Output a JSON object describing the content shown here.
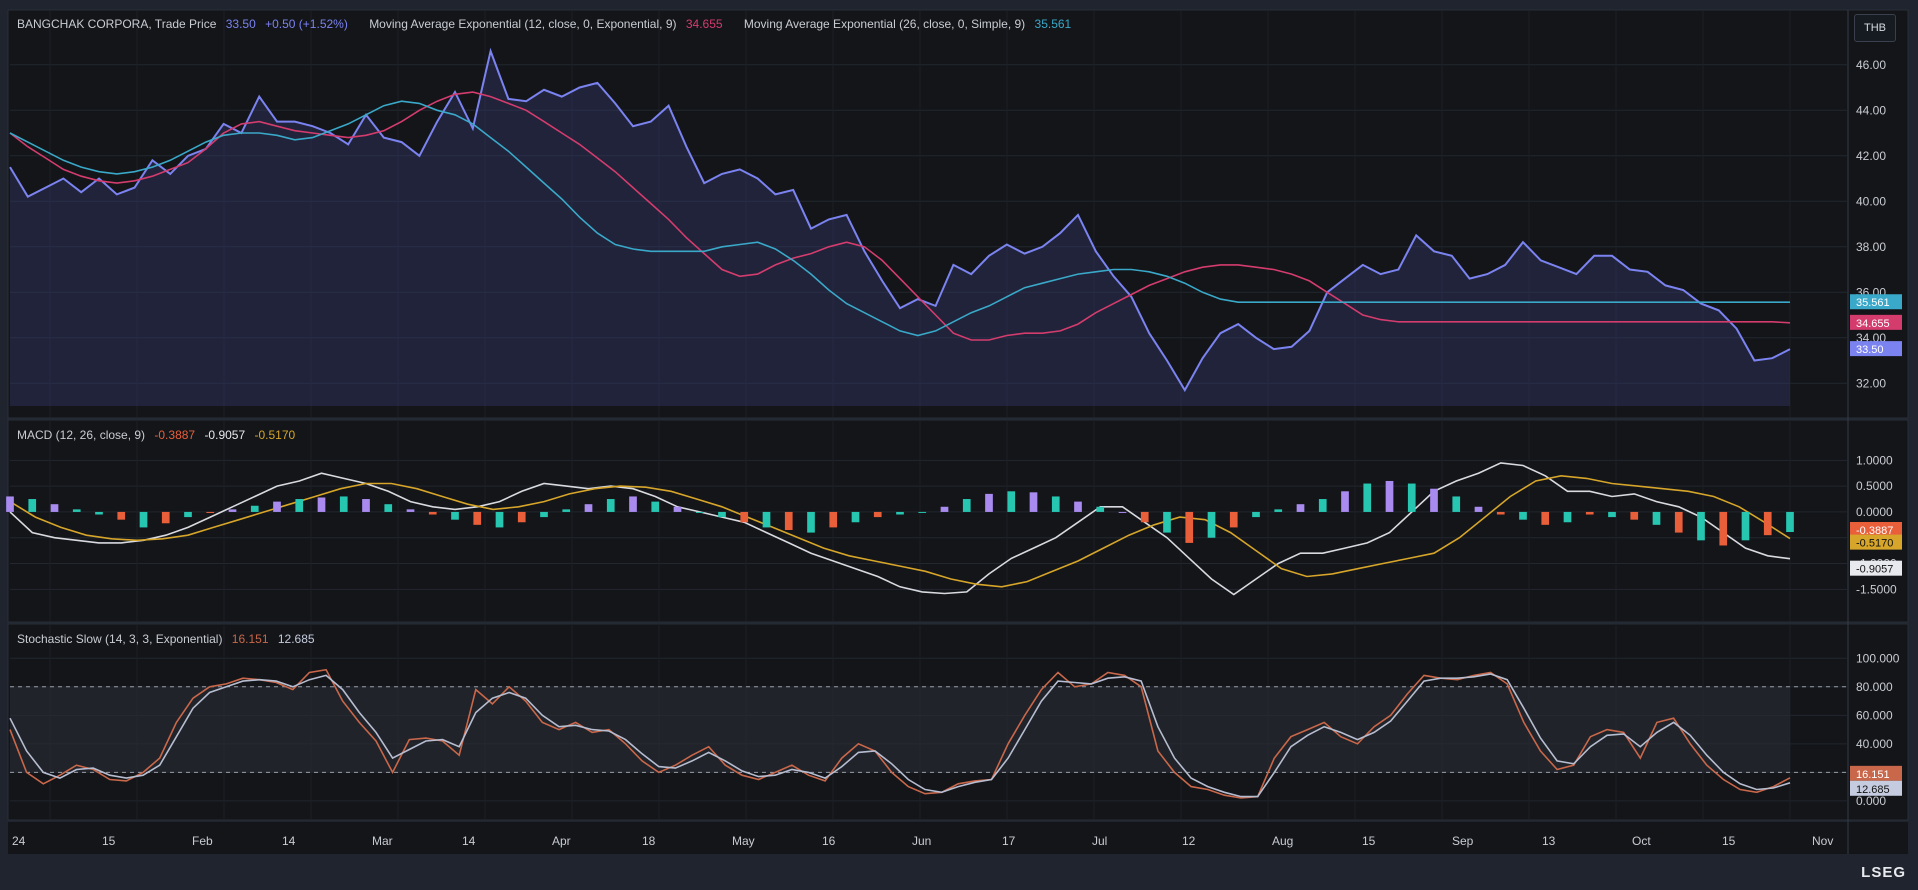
{
  "currency": "THB",
  "footer_logo": "LSEG",
  "price_legend": {
    "instrument": "BANGCHAK CORPORA, Trade Price",
    "last": "33.50",
    "change": "+0.50 (+1.52%)",
    "ema12_label": "Moving Average Exponential (12, close, 0, Exponential, 9)",
    "ema12_value": "34.655",
    "ma26_label": "Moving Average Exponential (26, close, 0, Simple, 9)",
    "ma26_value": "35.561"
  },
  "macd_legend": {
    "label": "MACD (12, 26, close, 9)",
    "hist": "-0.3887",
    "macd": "-0.9057",
    "signal": "-0.5170"
  },
  "stoch_legend": {
    "label": "Stochastic Slow (14, 3, 3, Exponential)",
    "k": "16.151",
    "d": "12.685"
  },
  "chart_data": [
    {
      "type": "line",
      "panel": "price",
      "x_index": [
        0,
        2,
        4,
        6,
        8,
        10,
        12,
        14,
        16,
        18,
        20,
        22,
        24,
        26,
        28,
        30,
        32,
        34,
        36,
        38,
        40,
        42,
        44,
        46,
        48,
        50,
        52,
        54,
        56,
        58,
        60,
        62,
        64,
        66,
        68,
        70,
        72,
        74,
        76,
        78,
        80,
        82,
        84,
        86,
        88,
        90,
        92,
        94,
        96,
        98,
        100,
        102,
        104,
        106,
        108,
        110,
        112,
        114,
        116,
        118,
        120,
        122,
        124,
        126,
        128,
        130,
        132,
        134,
        136,
        138,
        140,
        142,
        144,
        146,
        148,
        150,
        152,
        154,
        156,
        158,
        160,
        162,
        164,
        166,
        168,
        170,
        172,
        174,
        176,
        178,
        180,
        182,
        184,
        186,
        188,
        190,
        192,
        194,
        196,
        198,
        200
      ],
      "series": [
        {
          "name": "BANGCHAK CORPORA, Trade Price",
          "color": "#7b83f0",
          "values": [
            41.5,
            40.2,
            40.6,
            41.0,
            40.4,
            41.0,
            40.3,
            40.6,
            41.8,
            41.2,
            42.0,
            42.3,
            43.4,
            43.0,
            44.6,
            43.5,
            43.5,
            43.3,
            43.0,
            42.5,
            43.8,
            42.8,
            42.6,
            42.0,
            43.5,
            44.8,
            43.2,
            46.6,
            44.5,
            44.4,
            44.9,
            44.6,
            45.0,
            45.2,
            44.3,
            43.3,
            43.5,
            44.2,
            42.4,
            40.8,
            41.2,
            41.4,
            41.0,
            40.3,
            40.5,
            38.8,
            39.2,
            39.4,
            37.8,
            36.5,
            35.3,
            35.7,
            35.4,
            37.2,
            36.8,
            37.6,
            38.1,
            37.7,
            38.0,
            38.6,
            39.4,
            37.8,
            36.7,
            35.8,
            34.2,
            33.0,
            31.7,
            33.1,
            34.2,
            34.6,
            34.0,
            33.5,
            33.6,
            34.3,
            36.0,
            36.6,
            37.2,
            36.8,
            37.0,
            38.5,
            37.8,
            37.6,
            36.6,
            36.8,
            37.2,
            38.2,
            37.4,
            37.1,
            36.8,
            37.6,
            37.6,
            37.0,
            36.9,
            36.3,
            36.1,
            35.5,
            35.2,
            34.4,
            33.0,
            33.1,
            33.5
          ]
        },
        {
          "name": "Moving Average Exponential (12, close, 0, Exponential, 9)",
          "color": "#d43c6e",
          "values": [
            43.0,
            42.4,
            41.9,
            41.4,
            41.1,
            40.9,
            40.8,
            40.9,
            41.1,
            41.4,
            41.7,
            42.3,
            43.0,
            43.4,
            43.5,
            43.3,
            43.1,
            43.0,
            42.9,
            42.8,
            42.9,
            43.1,
            43.5,
            44.0,
            44.4,
            44.7,
            44.8,
            44.6,
            44.3,
            44.0,
            43.5,
            43.0,
            42.5,
            41.9,
            41.3,
            40.6,
            39.9,
            39.2,
            38.4,
            37.7,
            37.0,
            36.7,
            36.8,
            37.2,
            37.5,
            37.7,
            38.0,
            38.2,
            38.0,
            37.4,
            36.6,
            35.8,
            35.0,
            34.2,
            33.9,
            33.9,
            34.1,
            34.2,
            34.2,
            34.3,
            34.6,
            35.1,
            35.5,
            35.9,
            36.3,
            36.6,
            36.9,
            37.1,
            37.2,
            37.2,
            37.1,
            37.0,
            36.8,
            36.5,
            36.0,
            35.5,
            35.0,
            34.8,
            34.7,
            34.7,
            34.7,
            34.7,
            34.7,
            34.7,
            34.7,
            34.7,
            34.7,
            34.7,
            34.7,
            34.7,
            34.7,
            34.7,
            34.7,
            34.7,
            34.7,
            34.7,
            34.7,
            34.7,
            34.7,
            34.7,
            34.655
          ]
        },
        {
          "name": "Moving Average Exponential (26, close, 0, Simple, 9)",
          "color": "#3aa8c8",
          "values": [
            43.0,
            42.6,
            42.2,
            41.8,
            41.5,
            41.3,
            41.2,
            41.3,
            41.5,
            41.8,
            42.2,
            42.6,
            42.9,
            43.0,
            43.0,
            42.9,
            42.7,
            42.8,
            43.1,
            43.4,
            43.8,
            44.2,
            44.4,
            44.3,
            44.0,
            43.8,
            43.4,
            42.8,
            42.2,
            41.5,
            40.8,
            40.1,
            39.3,
            38.6,
            38.1,
            37.9,
            37.8,
            37.8,
            37.8,
            37.8,
            38.0,
            38.1,
            38.2,
            37.9,
            37.4,
            36.8,
            36.1,
            35.5,
            35.1,
            34.7,
            34.3,
            34.1,
            34.3,
            34.7,
            35.1,
            35.4,
            35.8,
            36.2,
            36.4,
            36.6,
            36.8,
            36.9,
            37.0,
            37.0,
            36.9,
            36.7,
            36.4,
            36.0,
            35.7,
            35.561,
            35.561,
            35.561,
            35.561,
            35.561,
            35.561,
            35.561,
            35.561,
            35.561,
            35.561,
            35.561,
            35.561,
            35.561,
            35.561,
            35.561,
            35.561,
            35.561,
            35.561,
            35.561,
            35.561,
            35.561,
            35.561,
            35.561,
            35.561,
            35.561,
            35.561,
            35.561,
            35.561,
            35.561,
            35.561,
            35.561,
            35.561
          ]
        }
      ],
      "ylim": [
        31.0,
        47.0
      ],
      "y_ticks": [
        "46.00",
        "44.00",
        "42.00",
        "40.00",
        "38.00",
        "36.00",
        "34.00",
        "32.00"
      ],
      "last_labels": [
        "35.561",
        "34.655",
        "33.50"
      ],
      "grid": true
    },
    {
      "type": "line",
      "panel": "macd",
      "series": [
        {
          "name": "MACD",
          "color": "#d8dae0",
          "values": [
            0.0,
            -0.4,
            -0.5,
            -0.55,
            -0.6,
            -0.6,
            -0.55,
            -0.45,
            -0.3,
            -0.1,
            0.1,
            0.3,
            0.5,
            0.6,
            0.75,
            0.65,
            0.55,
            0.4,
            0.2,
            0.1,
            0.05,
            0.1,
            0.2,
            0.4,
            0.55,
            0.5,
            0.45,
            0.5,
            0.45,
            0.3,
            0.1,
            0.0,
            -0.1,
            -0.2,
            -0.4,
            -0.6,
            -0.8,
            -0.95,
            -1.1,
            -1.25,
            -1.45,
            -1.55,
            -1.58,
            -1.55,
            -1.2,
            -0.9,
            -0.7,
            -0.5,
            -0.2,
            0.1,
            0.1,
            -0.2,
            -0.5,
            -0.9,
            -1.3,
            -1.6,
            -1.3,
            -1.0,
            -0.8,
            -0.8,
            -0.7,
            -0.6,
            -0.4,
            0.0,
            0.4,
            0.6,
            0.75,
            0.95,
            0.9,
            0.7,
            0.4,
            0.4,
            0.3,
            0.35,
            0.2,
            0.1,
            -0.1,
            -0.4,
            -0.7,
            -0.85,
            -0.9057
          ]
        },
        {
          "name": "Signal",
          "color": "#d6a52a",
          "values": [
            0.2,
            -0.1,
            -0.3,
            -0.45,
            -0.52,
            -0.55,
            -0.52,
            -0.45,
            -0.3,
            -0.15,
            0.0,
            0.15,
            0.3,
            0.45,
            0.55,
            0.55,
            0.45,
            0.3,
            0.15,
            0.05,
            0.1,
            0.2,
            0.35,
            0.45,
            0.5,
            0.48,
            0.4,
            0.25,
            0.1,
            -0.1,
            -0.3,
            -0.5,
            -0.7,
            -0.85,
            -0.95,
            -1.05,
            -1.15,
            -1.3,
            -1.4,
            -1.45,
            -1.35,
            -1.15,
            -0.95,
            -0.7,
            -0.45,
            -0.25,
            -0.1,
            -0.15,
            -0.4,
            -0.75,
            -1.1,
            -1.25,
            -1.2,
            -1.1,
            -1.0,
            -0.9,
            -0.8,
            -0.5,
            -0.1,
            0.3,
            0.6,
            0.7,
            0.65,
            0.55,
            0.5,
            0.45,
            0.4,
            0.3,
            0.1,
            -0.2,
            -0.517
          ]
        },
        {
          "name": "Histogram",
          "color": "#e85f3a",
          "values": [
            0.3,
            0.25,
            0.15,
            0.05,
            -0.05,
            -0.15,
            -0.3,
            -0.22,
            -0.1,
            -0.02,
            0.05,
            0.12,
            0.2,
            0.25,
            0.28,
            0.3,
            0.25,
            0.15,
            0.05,
            -0.05,
            -0.15,
            -0.25,
            -0.3,
            -0.2,
            -0.1,
            0.05,
            0.15,
            0.25,
            0.3,
            0.2,
            0.1,
            0.0,
            -0.1,
            -0.2,
            -0.3,
            -0.35,
            -0.4,
            -0.3,
            -0.2,
            -0.1,
            -0.05,
            0.0,
            0.1,
            0.25,
            0.35,
            0.4,
            0.38,
            0.3,
            0.2,
            0.1,
            0.0,
            -0.2,
            -0.4,
            -0.6,
            -0.5,
            -0.3,
            -0.1,
            0.05,
            0.15,
            0.25,
            0.4,
            0.55,
            0.6,
            0.55,
            0.45,
            0.3,
            0.1,
            -0.05,
            -0.15,
            -0.25,
            -0.2,
            -0.05,
            -0.1,
            -0.15,
            -0.25,
            -0.4,
            -0.55,
            -0.65,
            -0.55,
            -0.45,
            -0.3887
          ]
        }
      ],
      "ylim": [
        -1.9,
        1.2
      ],
      "y_ticks": [
        "1.0000",
        "0.5000",
        "0.0000",
        "-0.5000",
        "-1.0000",
        "-1.5000"
      ],
      "last_labels": [
        "-0.3887",
        "-0.5170",
        "-0.9057"
      ],
      "grid": true
    },
    {
      "type": "line",
      "panel": "stochastic",
      "series": [
        {
          "name": "%K",
          "color": "#c9674a",
          "values": [
            50,
            20,
            12,
            18,
            25,
            22,
            15,
            14,
            20,
            30,
            55,
            72,
            80,
            82,
            86,
            85,
            83,
            78,
            90,
            92,
            70,
            55,
            42,
            20,
            43,
            44,
            42,
            32,
            78,
            68,
            80,
            70,
            55,
            50,
            55,
            48,
            50,
            40,
            28,
            20,
            25,
            32,
            38,
            25,
            18,
            15,
            20,
            25,
            18,
            14,
            30,
            40,
            35,
            20,
            10,
            5,
            6,
            12,
            14,
            15,
            40,
            60,
            78,
            90,
            80,
            82,
            90,
            88,
            80,
            35,
            20,
            10,
            8,
            4,
            2,
            3,
            30,
            45,
            50,
            55,
            45,
            40,
            52,
            60,
            75,
            88,
            86,
            85,
            88,
            90,
            82,
            55,
            35,
            22,
            25,
            45,
            50,
            48,
            30,
            55,
            58,
            40,
            25,
            15,
            8,
            6,
            10,
            16.151
          ]
        },
        {
          "name": "%D",
          "color": "#b7bdd0",
          "values": [
            58,
            35,
            20,
            16,
            22,
            23,
            18,
            16,
            18,
            25,
            45,
            65,
            76,
            80,
            84,
            85,
            84,
            80,
            85,
            88,
            78,
            62,
            48,
            30,
            36,
            42,
            43,
            38,
            62,
            72,
            76,
            72,
            60,
            52,
            53,
            50,
            49,
            43,
            33,
            24,
            23,
            28,
            34,
            28,
            21,
            17,
            18,
            22,
            20,
            16,
            24,
            34,
            35,
            26,
            15,
            8,
            6,
            10,
            13,
            15,
            30,
            50,
            70,
            84,
            83,
            82,
            86,
            87,
            84,
            52,
            30,
            16,
            10,
            6,
            3,
            3,
            20,
            38,
            46,
            52,
            48,
            43,
            48,
            56,
            70,
            84,
            86,
            86,
            87,
            89,
            85,
            65,
            44,
            28,
            26,
            38,
            46,
            47,
            38,
            48,
            55,
            46,
            32,
            20,
            12,
            8,
            9,
            12.685
          ]
        }
      ],
      "ylim": [
        -5,
        103
      ],
      "y_ticks": [
        "100.000",
        "80.000",
        "60.000",
        "40.000",
        "20.000",
        "0.000"
      ],
      "band": [
        20,
        80
      ],
      "last_labels": [
        "16.151",
        "12.685"
      ],
      "grid": true
    }
  ],
  "x_axis_ticks": [
    "24",
    "15",
    "Feb",
    "14",
    "Mar",
    "14",
    "Apr",
    "18",
    "May",
    "16",
    "Jun",
    "17",
    "Jul",
    "12",
    "Aug",
    "15",
    "Sep",
    "13",
    "Oct",
    "15",
    "Nov"
  ]
}
